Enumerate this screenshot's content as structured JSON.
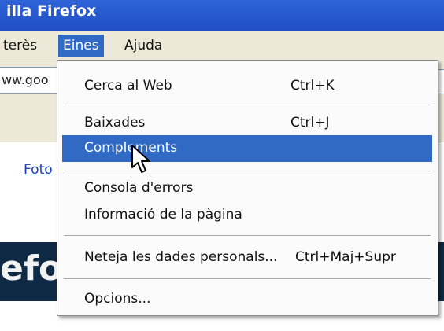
{
  "window": {
    "title": "illa Firefox"
  },
  "menubar": {
    "items": [
      "terès",
      "Eines",
      "Ajuda"
    ],
    "active": "Eines"
  },
  "navbar": {
    "url": "ww.goo"
  },
  "content": {
    "link": "Foto",
    "banner": "efox"
  },
  "menu": {
    "items": [
      {
        "label": "Cerca al Web",
        "shortcut": "Ctrl+K"
      },
      {
        "label": "Baixades",
        "shortcut": "Ctrl+J"
      },
      {
        "label": "Complements",
        "shortcut": ""
      },
      {
        "label": "Consola d'errors",
        "shortcut": ""
      },
      {
        "label": "Informació de la pàgina",
        "shortcut": ""
      },
      {
        "label": "Neteja les dades personals...",
        "shortcut": "Ctrl+Maj+Supr"
      },
      {
        "label": "Opcions...",
        "shortcut": ""
      }
    ],
    "highlighted": "Complements"
  },
  "colors": {
    "accent": "#316ac5",
    "titlebar": "#1f4ec2"
  }
}
